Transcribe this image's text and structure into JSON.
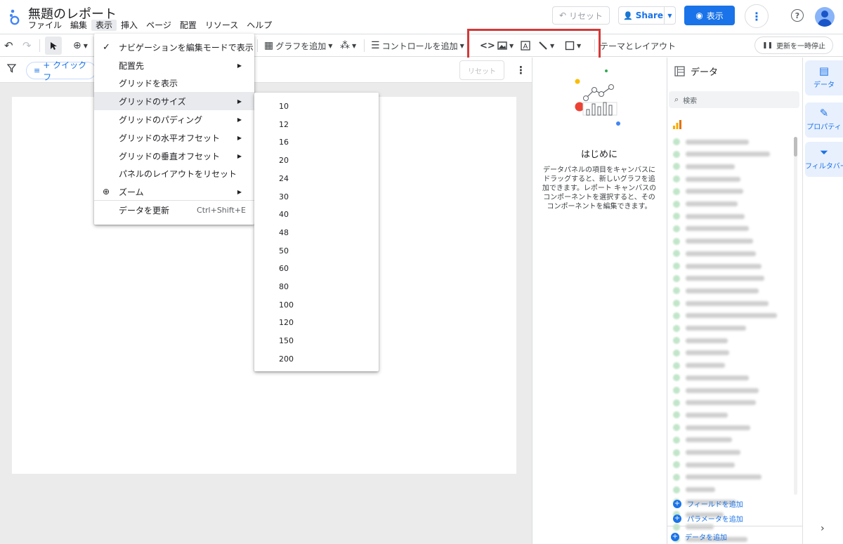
{
  "header": {
    "title": "無題のレポート",
    "menus": [
      "ファイル",
      "編集",
      "表示",
      "挿入",
      "ページ",
      "配置",
      "リソース",
      "ヘルプ"
    ],
    "active_menu": "表示",
    "reset_label": "リセット",
    "share_label": "Share",
    "view_label": "表示"
  },
  "toolbar": {
    "add_chart_label": "グラフを追加",
    "add_control_label": "コントロールを追加",
    "theme_layout_label": "テーマとレイアウト",
    "pause_updates_label": "更新を一時停止"
  },
  "filterbar": {
    "quick_filter_label": "+ クイック フ",
    "reset_label": "リセット"
  },
  "view_menu": {
    "items": [
      {
        "label": "ナビゲーションを編集モードで表示",
        "checked": true,
        "submenu": false
      },
      {
        "label": "配置先",
        "submenu": true
      },
      {
        "label": "グリッドを表示",
        "submenu": false
      },
      {
        "label": "グリッドのサイズ",
        "submenu": true,
        "highlighted": true
      },
      {
        "label": "グリッドのパディング",
        "submenu": true
      },
      {
        "label": "グリッドの水平オフセット",
        "submenu": true
      },
      {
        "label": "グリッドの垂直オフセット",
        "submenu": true
      },
      {
        "label": "パネルのレイアウトをリセット",
        "submenu": false
      },
      {
        "label": "ズーム",
        "submenu": true,
        "icon": "zoom-icon"
      },
      {
        "label": "データを更新",
        "shortcut": "Ctrl+Shift+E"
      }
    ]
  },
  "grid_size_menu": {
    "options": [
      "10",
      "12",
      "16",
      "20",
      "24",
      "30",
      "40",
      "48",
      "50",
      "60",
      "80",
      "100",
      "120",
      "150",
      "200"
    ]
  },
  "getting_started": {
    "title": "はじめに",
    "text": "データパネルの項目をキャンバスにドラッグすると、新しいグラフを追加できます。レポート キャンバスのコンポーネントを選択すると、そのコンポーネントを編集できます。"
  },
  "data_panel": {
    "title": "データ",
    "search_placeholder": "検索",
    "add_field_label": "フィールドを追加",
    "add_parameter_label": "パラメータを追加",
    "add_data_label": "データを追加"
  },
  "right_rail": {
    "tabs": [
      "データ",
      "プロパティ",
      "フィルタバー"
    ]
  },
  "colors": {
    "accent": "#1a73e8",
    "highlight_box": "#d33a3a"
  }
}
